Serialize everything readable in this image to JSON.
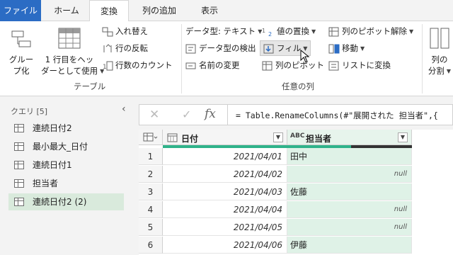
{
  "tabs": [
    {
      "label": "ファイル"
    },
    {
      "label": "ホーム"
    },
    {
      "label": "変換"
    },
    {
      "label": "列の追加"
    },
    {
      "label": "表示"
    }
  ],
  "ribbon": {
    "group_by": {
      "line1": "グルー",
      "line2": "プ化"
    },
    "first_row_header": {
      "line1": "1 行目をヘッ",
      "line2": "ダーとして使用"
    },
    "transpose": "入れ替え",
    "reverse_rows": "行の反転",
    "count_rows": "行数のカウント",
    "table_group_label": "テーブル",
    "data_type": "データ型: テキスト",
    "detect_type": "データ型の検出",
    "rename": "名前の変更",
    "replace_values": "値の置換",
    "fill": "フィル",
    "pivot_column": "列のピボット",
    "unpivot": "列のピボット解除",
    "move": "移動",
    "to_list": "リストに変換",
    "any_column_label": "任意の列",
    "split": {
      "line1": "列の",
      "line2": "分割"
    }
  },
  "queries": {
    "header": "クエリ",
    "count": "[5]",
    "items": [
      {
        "label": "連続日付2"
      },
      {
        "label": "最小最大_日付"
      },
      {
        "label": "連続日付1"
      },
      {
        "label": "担当者"
      },
      {
        "label": "連続日付2 (2)"
      }
    ]
  },
  "formula": {
    "cancel": "✕",
    "confirm": "✓",
    "fx": "fx",
    "text": "= Table.RenameColumns(#\"展開された 担当者\",{"
  },
  "grid": {
    "columns": [
      {
        "type_icon": "calendar",
        "label": "日付"
      },
      {
        "type_icon": "ABC",
        "label": "担当者"
      }
    ],
    "rows": [
      {
        "num": "1",
        "date": "2021/04/01",
        "name": "田中"
      },
      {
        "num": "2",
        "date": "2021/04/02",
        "name": "null"
      },
      {
        "num": "3",
        "date": "2021/04/03",
        "name": "佐藤"
      },
      {
        "num": "4",
        "date": "2021/04/04",
        "name": "null"
      },
      {
        "num": "5",
        "date": "2021/04/05",
        "name": "null"
      },
      {
        "num": "6",
        "date": "2021/04/06",
        "name": "伊藤"
      }
    ]
  },
  "colors": {
    "file_tab": "#2b6cc4",
    "quality_bar": "#2fb38a",
    "selected_column_bg": "#dff2e7",
    "selected_query_bg": "#d9eadc"
  }
}
